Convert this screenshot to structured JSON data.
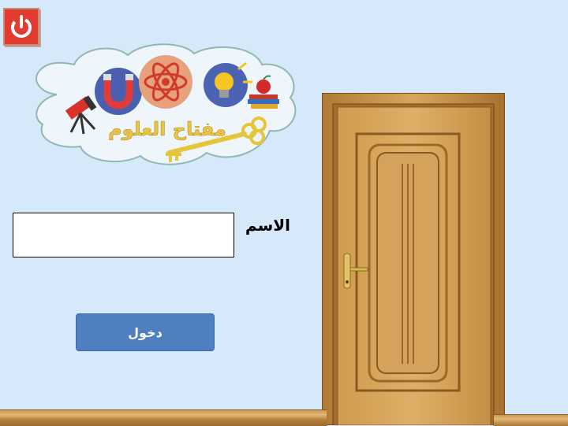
{
  "power_button": {
    "icon": "power-icon",
    "color": "#e13c31"
  },
  "logo": {
    "text": "مفتاح العلوم"
  },
  "form": {
    "name_label": "الاسم",
    "name_value": "",
    "name_placeholder": "",
    "enter_label": "دخول"
  },
  "colors": {
    "background": "#d6e9fb",
    "button": "#4f7fc0",
    "wood": "#c8923f"
  }
}
